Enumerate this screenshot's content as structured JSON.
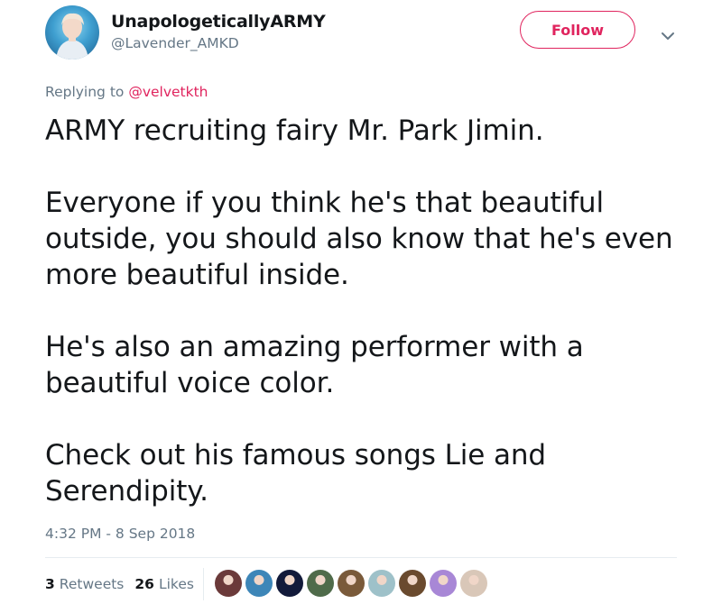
{
  "user": {
    "display_name": "UnapologeticallyARMY",
    "handle": "@Lavender_AMKD"
  },
  "actions": {
    "follow_label": "Follow"
  },
  "reply": {
    "prefix": "Replying to ",
    "mention": "@velvetkth"
  },
  "tweet": {
    "paragraphs": [
      "ARMY recruiting fairy Mr. Park Jimin.",
      "Everyone if you think he's that beautiful outside, you should also know that he's even more beautiful inside.",
      "He's also an amazing performer with a beautiful voice color.",
      "Check out his famous songs Lie and Serendipity."
    ],
    "timestamp": "4:32 PM - 8 Sep 2018"
  },
  "stats": {
    "retweets_count": "3",
    "retweets_label": "Retweets",
    "likes_count": "26",
    "likes_label": "Likes"
  },
  "colors": {
    "accent": "#e0245e",
    "secondary_text": "#657786",
    "primary_text": "#14171a"
  },
  "likers": [
    {
      "icon": "liker-avatar",
      "color": "#6b3a3a"
    },
    {
      "icon": "liker-avatar",
      "color": "#3d86b8"
    },
    {
      "icon": "liker-avatar",
      "color": "#121a3a"
    },
    {
      "icon": "liker-avatar",
      "color": "#4f6b4a"
    },
    {
      "icon": "liker-avatar",
      "color": "#7a5a3a"
    },
    {
      "icon": "liker-avatar",
      "color": "#9ec1c9"
    },
    {
      "icon": "liker-avatar",
      "color": "#6a4a2e"
    },
    {
      "icon": "liker-avatar",
      "color": "#a887d6"
    },
    {
      "icon": "liker-avatar",
      "color": "#d9c7b8"
    }
  ]
}
